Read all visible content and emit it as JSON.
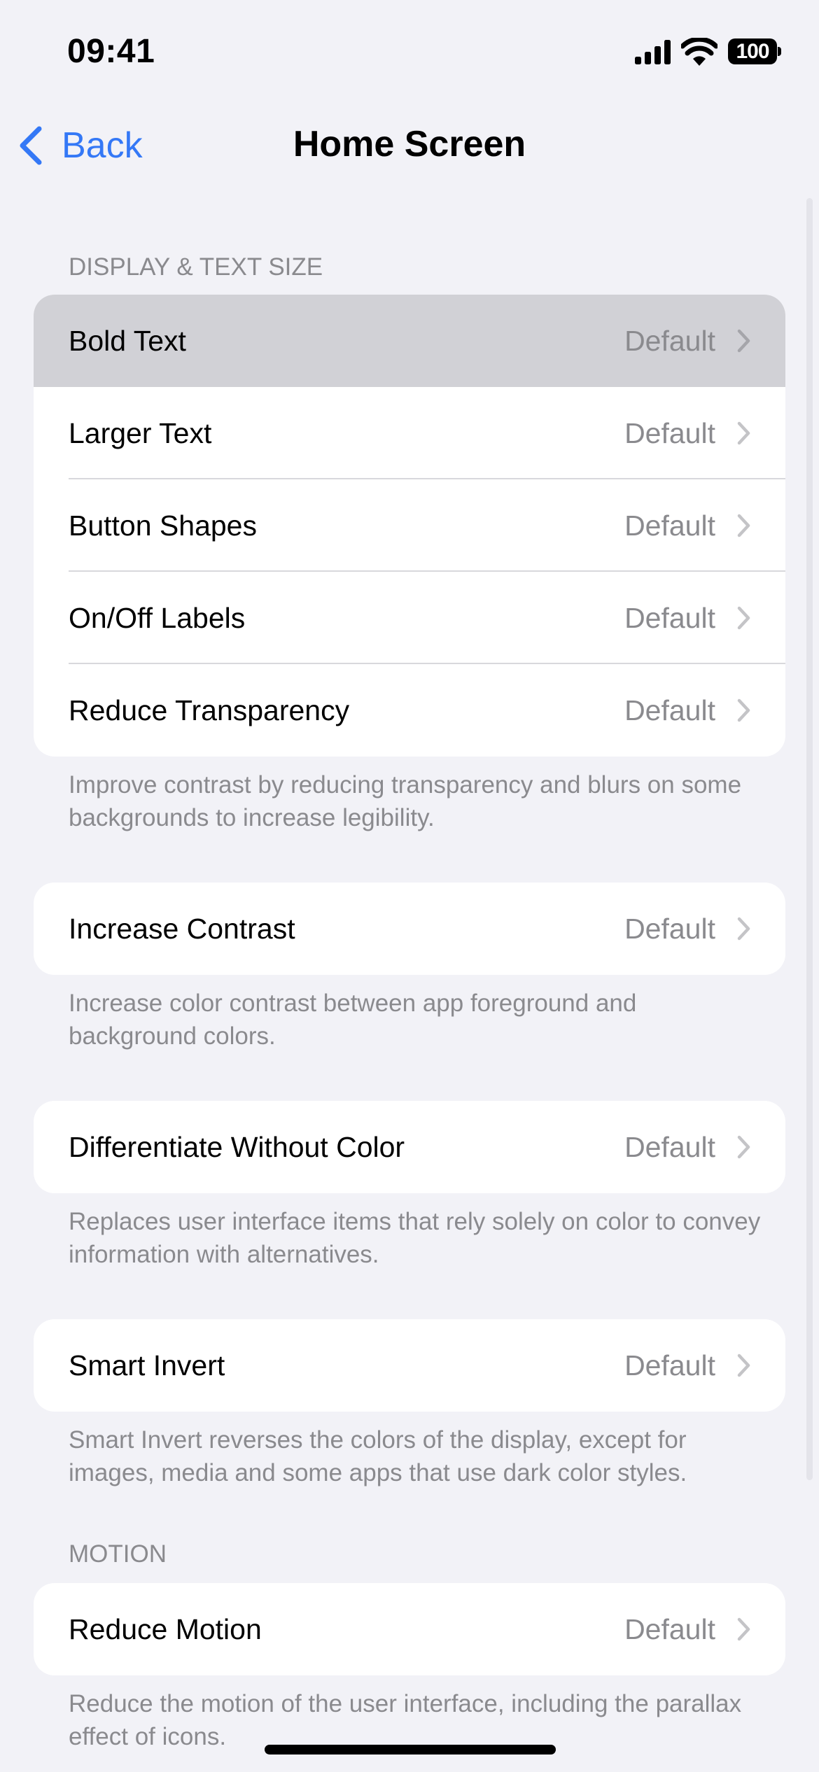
{
  "status_bar": {
    "time": "09:41",
    "signal_icon": "cellular-signal-icon",
    "wifi_icon": "wifi-icon",
    "battery_level": "100"
  },
  "nav": {
    "back_label": "Back",
    "title": "Home Screen"
  },
  "colors": {
    "background": "#F2F2F7",
    "accent": "#3478F6",
    "secondary_text": "#8A8A8E",
    "highlight_row": "#D1D1D6"
  },
  "sections": [
    {
      "header": "DISPLAY & TEXT SIZE",
      "rows": [
        {
          "label": "Bold Text",
          "value": "Default",
          "highlighted": true
        },
        {
          "label": "Larger Text",
          "value": "Default"
        },
        {
          "label": "Button Shapes",
          "value": "Default"
        },
        {
          "label": "On/Off Labels",
          "value": "Default"
        },
        {
          "label": "Reduce Transparency",
          "value": "Default"
        }
      ],
      "footer": "Improve contrast by reducing transparency and blurs on some backgrounds to increase legibility."
    },
    {
      "rows": [
        {
          "label": "Increase Contrast",
          "value": "Default"
        }
      ],
      "footer": "Increase color contrast between app foreground and background colors."
    },
    {
      "rows": [
        {
          "label": "Differentiate Without Color",
          "value": "Default"
        }
      ],
      "footer": "Replaces user interface items that rely solely on color to convey information with alternatives."
    },
    {
      "rows": [
        {
          "label": "Smart Invert",
          "value": "Default"
        }
      ],
      "footer": "Smart Invert reverses the colors of the display, except for images, media and some apps that use dark color styles."
    },
    {
      "header": "MOTION",
      "rows": [
        {
          "label": "Reduce Motion",
          "value": "Default"
        }
      ],
      "footer": "Reduce the motion of the user interface, including the parallax effect of icons."
    }
  ]
}
